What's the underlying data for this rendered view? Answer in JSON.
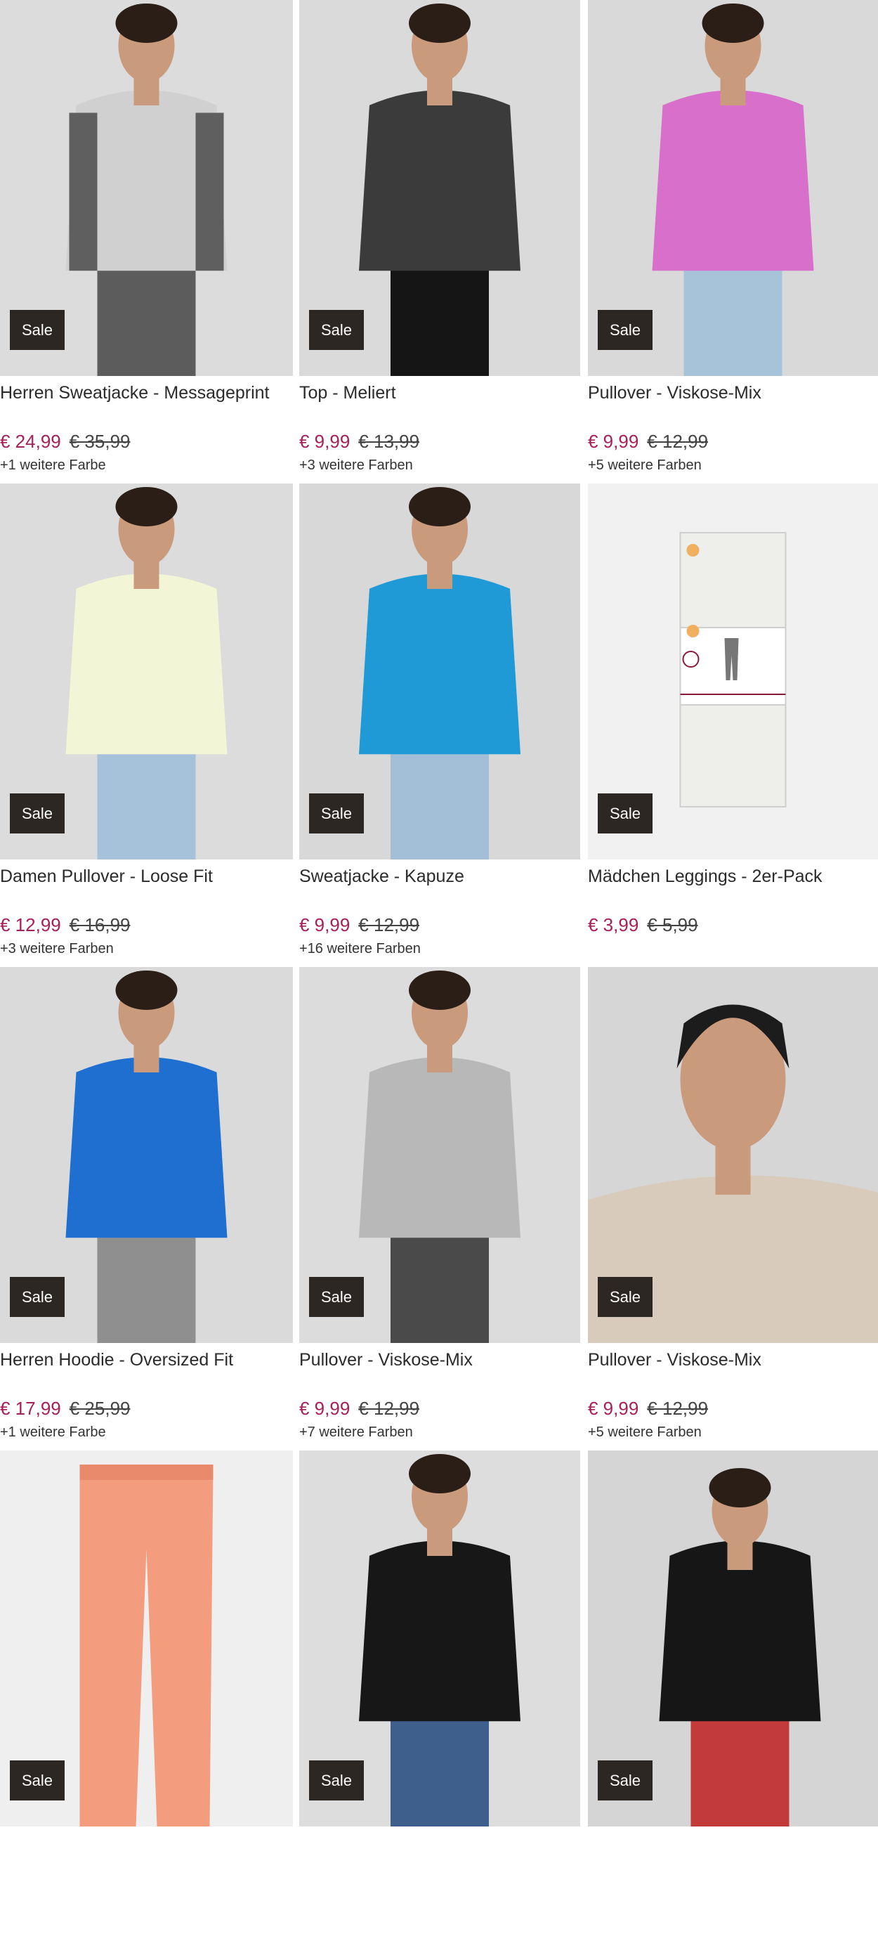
{
  "products": [
    {
      "title": "Herren Sweatjacke - Messageprint",
      "price_new": "€ 24,99",
      "price_old": "€ 35,99",
      "colors": "+1 weitere Farbe",
      "badge": "Sale",
      "bg": "#dcdcdc",
      "garment": "#d0d0d0",
      "accent": "#5c5c5c",
      "image": "man-sweatjacket"
    },
    {
      "title": "Top - Meliert",
      "price_new": "€ 9,99",
      "price_old": "€ 13,99",
      "colors": "+3 weitere Farben",
      "badge": "Sale",
      "bg": "#dadada",
      "garment": "#3b3b3b",
      "accent": "#151515",
      "image": "woman-tank-top"
    },
    {
      "title": "Pullover - Viskose-Mix",
      "price_new": "€ 9,99",
      "price_old": "€ 12,99",
      "colors": "+5 weitere Farben",
      "badge": "Sale",
      "bg": "#d9d9d9",
      "garment": "#d86fcb",
      "accent": "#a7c3da",
      "image": "woman-pink-pullover"
    },
    {
      "title": "Damen Pullover - Loose Fit",
      "price_new": "€ 12,99",
      "price_old": "€ 16,99",
      "colors": "+3 weitere Farben",
      "badge": "Sale",
      "bg": "#dcdcdc",
      "garment": "#f2f6d6",
      "accent": "#a6c2da",
      "image": "woman-loose-pullover"
    },
    {
      "title": "Sweatjacke - Kapuze",
      "price_new": "€ 9,99",
      "price_old": "€ 12,99",
      "colors": "+16 weitere Farben",
      "badge": "Sale",
      "bg": "#d8d8d8",
      "garment": "#1f9ad6",
      "accent": "#a3bfd8",
      "image": "woman-blue-hoodie"
    },
    {
      "title": "Mädchen Leggings - 2er-Pack",
      "price_new": "€ 3,99",
      "price_old": "€ 5,99",
      "colors": "",
      "badge": "Sale",
      "bg": "#f1f1f1",
      "garment": "#eeeeea",
      "accent": "#8a1a3a",
      "image": "leggings-pack"
    },
    {
      "title": "Herren Hoodie - Oversized Fit",
      "price_new": "€ 17,99",
      "price_old": "€ 25,99",
      "colors": "+1 weitere Farbe",
      "badge": "Sale",
      "bg": "#dadada",
      "garment": "#1f6fd0",
      "accent": "#8f8f8f",
      "image": "man-blue-hoodie"
    },
    {
      "title": "Pullover - Viskose-Mix",
      "price_new": "€ 9,99",
      "price_old": "€ 12,99",
      "colors": "+7 weitere Farben",
      "badge": "Sale",
      "bg": "#dcdcdc",
      "garment": "#b8b8b8",
      "accent": "#4a4a4a",
      "image": "woman-grey-pullover"
    },
    {
      "title": "Pullover - Viskose-Mix",
      "price_new": "€ 9,99",
      "price_old": "€ 12,99",
      "colors": "+5 weitere Farben",
      "badge": "Sale",
      "bg": "#d6d6d6",
      "garment": "#d8cbbb",
      "accent": "#1c1c1c",
      "image": "woman-beige-pullover"
    },
    {
      "title": "",
      "price_new": "",
      "price_old": "",
      "colors": "",
      "badge": "Sale",
      "bg": "#efefef",
      "garment": "#f39c7e",
      "accent": "#e88a6b",
      "image": "salmon-pants"
    },
    {
      "title": "",
      "price_new": "",
      "price_old": "",
      "colors": "",
      "badge": "Sale",
      "bg": "#dddddd",
      "garment": "#171717",
      "accent": "#3e5f8c",
      "image": "man-black-hoodie"
    },
    {
      "title": "",
      "price_new": "",
      "price_old": "",
      "colors": "",
      "badge": "Sale",
      "bg": "#d5d5d5",
      "garment": "#161616",
      "accent": "#c23a3a",
      "image": "man-black-hoodie-seated"
    }
  ]
}
